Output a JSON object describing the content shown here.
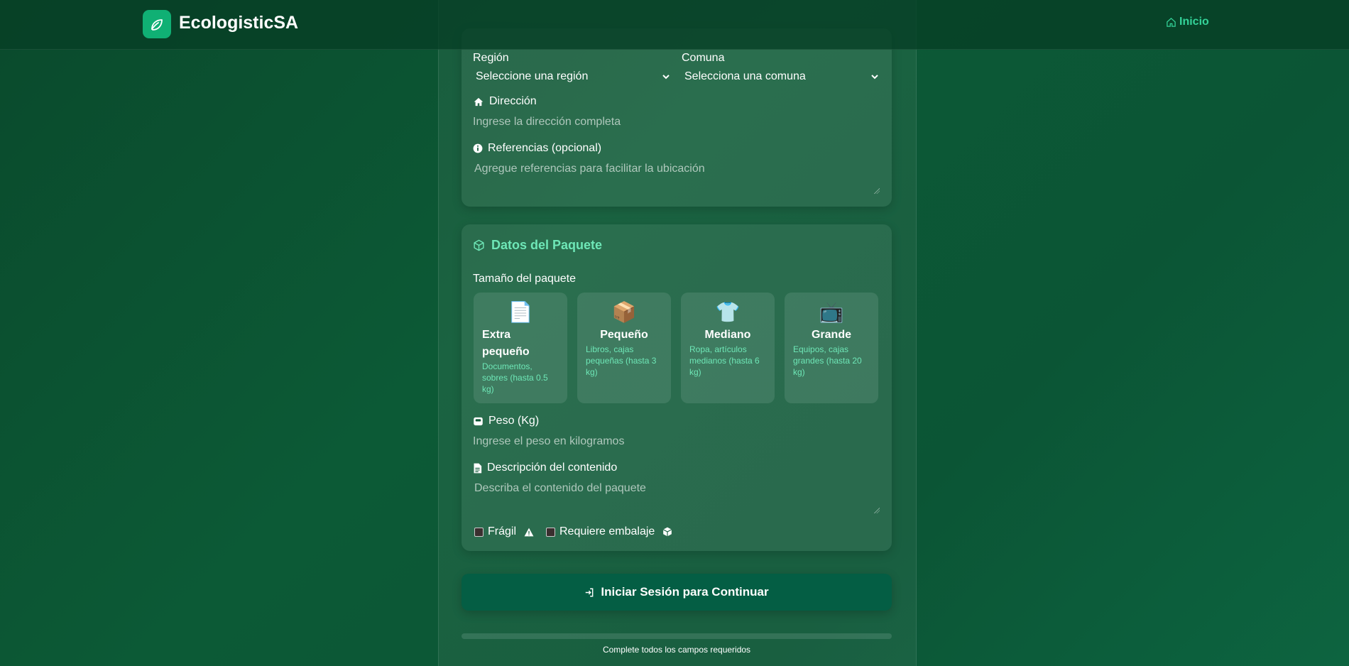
{
  "header": {
    "brand": "EcologisticSA",
    "inicio": "Inicio"
  },
  "address": {
    "region_label": "Región",
    "region_value": "Seleccione una región",
    "comuna_label": "Comuna",
    "comuna_value": "Selecciona una comuna",
    "direccion_label": "Dirección",
    "direccion_placeholder": "Ingrese la dirección completa",
    "referencias_label": "Referencias (opcional)",
    "referencias_placeholder": "Agregue referencias para facilitar la ubicación"
  },
  "package": {
    "title": "Datos del Paquete",
    "size_label": "Tamaño del paquete",
    "sizes": [
      {
        "icon": "📄",
        "name": "Extra pequeño",
        "desc": "Documentos, sobres (hasta 0.5 kg)"
      },
      {
        "icon": "📦",
        "name": "Pequeño",
        "desc": "Libros, cajas pequeñas (hasta 3 kg)"
      },
      {
        "icon": "👕",
        "name": "Mediano",
        "desc": "Ropa, artículos medianos (hasta 6 kg)"
      },
      {
        "icon": "📺",
        "name": "Grande",
        "desc": "Equipos, cajas grandes (hasta 20 kg)"
      }
    ],
    "peso_label": "Peso (Kg)",
    "peso_placeholder": "Ingrese el peso en kilogramos",
    "descripcion_label": "Descripción del contenido",
    "descripcion_placeholder": "Describa el contenido del paquete",
    "fragil_label": "Frágil",
    "embalaje_label": "Requiere embalaje"
  },
  "submit_label": "Iniciar Sesión para Continuar",
  "footer_note": "Complete todos los campos requeridos",
  "colors": {
    "accent": "#34d399",
    "button": "#045e44",
    "logo": "#10b074"
  }
}
